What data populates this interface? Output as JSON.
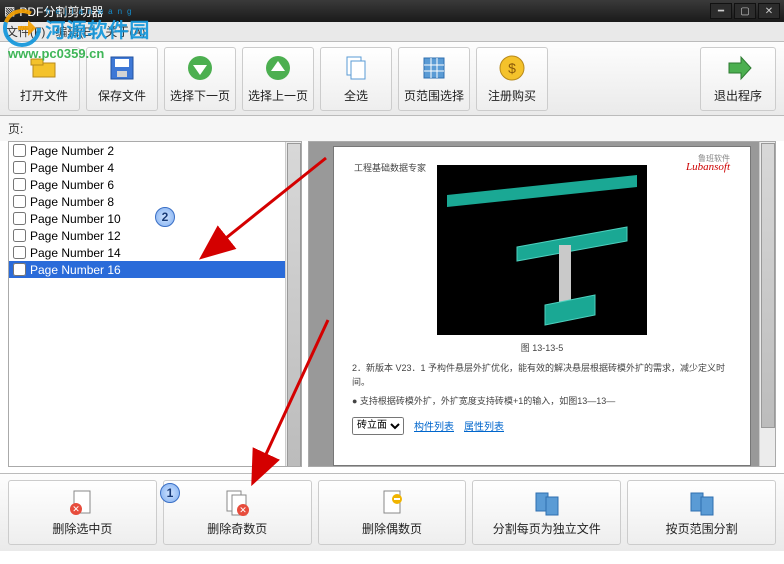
{
  "window": {
    "title": "PDF分割剪切器",
    "icon": "pdf-app-icon"
  },
  "menu": {
    "file": "文件(F)",
    "edit": "编辑(E)",
    "about": "关于(A)"
  },
  "toolbar": {
    "open": "打开文件",
    "save": "保存文件",
    "nextpage": "选择下一页",
    "prevpage": "选择上一页",
    "selectall": "全选",
    "range": "页范围选择",
    "register": "注册购买",
    "exit": "退出程序"
  },
  "pages_label": "页:",
  "pages": [
    {
      "label": "Page Number 2",
      "checked": false,
      "selected": false
    },
    {
      "label": "Page Number 4",
      "checked": false,
      "selected": false
    },
    {
      "label": "Page Number 6",
      "checked": false,
      "selected": false
    },
    {
      "label": "Page Number 8",
      "checked": false,
      "selected": false
    },
    {
      "label": "Page Number 10",
      "checked": false,
      "selected": false
    },
    {
      "label": "Page Number 12",
      "checked": false,
      "selected": false
    },
    {
      "label": "Page Number 14",
      "checked": false,
      "selected": false
    },
    {
      "label": "Page Number 16",
      "checked": false,
      "selected": true
    }
  ],
  "preview": {
    "header": "工程基础数据专家",
    "brand_cn": "鲁班软件",
    "brand_en": "Lubansoft",
    "fig_caption": "图 13-13-5",
    "bullet1": "2．新版本 V23．1 予构件悬层外扩优化，能有效的解决悬层根据砖模外扩的需求，减少定义时间。",
    "bullet2": "● 支持根据砖模外扩，外扩宽度支持砖模+1的输入，如图13—13—",
    "select_value": "砖立面",
    "link1": "构件列表",
    "link2": "属性列表"
  },
  "bottom": {
    "del_selected": "删除选中页",
    "del_odd": "删除奇数页",
    "del_even": "删除偶数页",
    "split_each": "分割每页为独立文件",
    "split_range": "按页范围分割"
  },
  "annotations": {
    "badge1": "1",
    "badge2": "2"
  },
  "watermark": {
    "pinyin": "hejianwang",
    "name": "河源软件园",
    "url": "www.pc0359.cn"
  }
}
